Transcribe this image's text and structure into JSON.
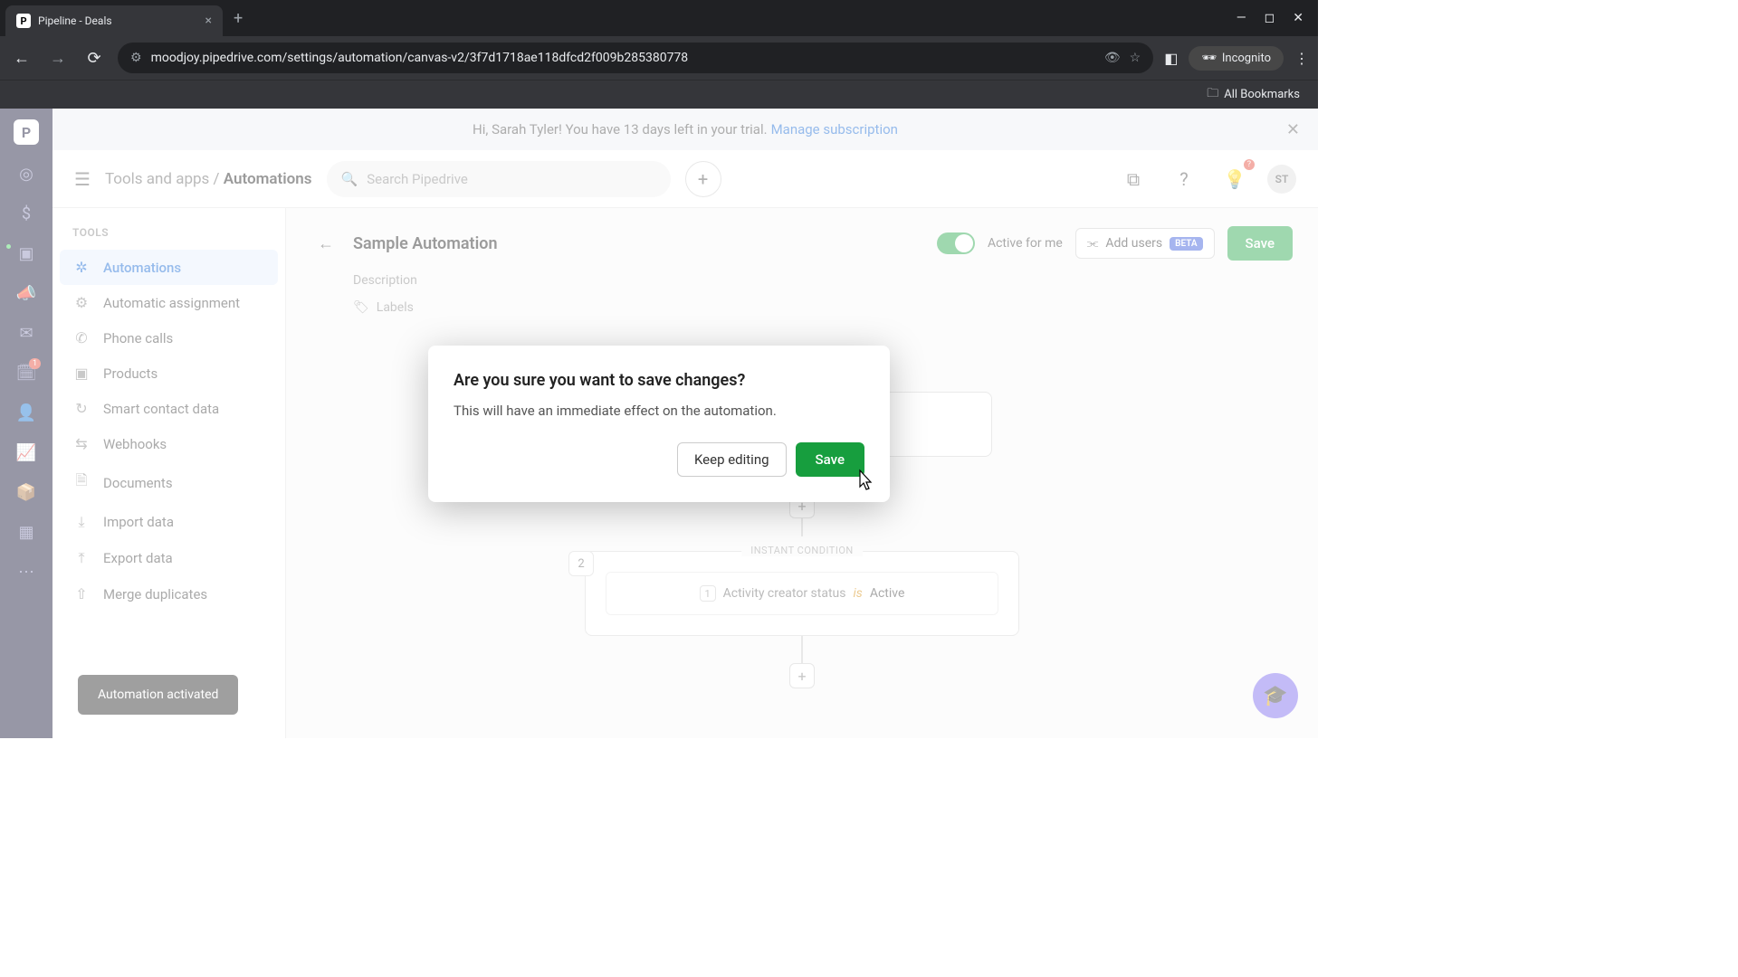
{
  "browser": {
    "tab_title": "Pipeline - Deals",
    "tab_favicon": "P",
    "url": "moodjoy.pipedrive.com/settings/automation/canvas-v2/3f7d1718ae118dfcd2f009b285380778",
    "incognito": "Incognito",
    "bookmarks_label": "All Bookmarks"
  },
  "banner": {
    "text": "Hi, Sarah Tyler! You have 13 days left in your trial.",
    "link": "Manage subscription"
  },
  "header": {
    "breadcrumb_parent": "Tools and apps",
    "breadcrumb_current": "Automations",
    "search_placeholder": "Search Pipedrive",
    "gift_badge": "?",
    "avatar": "ST"
  },
  "sidebar": {
    "heading": "TOOLS",
    "items": [
      {
        "icon": "✲",
        "label": "Automations"
      },
      {
        "icon": "⚙",
        "label": "Automatic assignment"
      },
      {
        "icon": "✆",
        "label": "Phone calls"
      },
      {
        "icon": "▣",
        "label": "Products"
      },
      {
        "icon": "↻",
        "label": "Smart contact data"
      },
      {
        "icon": "⇆",
        "label": "Webhooks"
      },
      {
        "icon": "🗎",
        "label": "Documents"
      },
      {
        "icon": "⤓",
        "label": "Import data"
      },
      {
        "icon": "⤒",
        "label": "Export data"
      },
      {
        "icon": "⇧",
        "label": "Merge duplicates"
      }
    ]
  },
  "panel": {
    "title": "Sample Automation",
    "description_placeholder": "Description",
    "labels_placeholder": "Labels",
    "active_label": "Active for me",
    "add_users": "Add users",
    "beta": "BETA",
    "save": "Save"
  },
  "canvas": {
    "step2_num": "2",
    "condition_label": "INSTANT CONDITION",
    "cond_badge": "1",
    "cond_field": "Activity creator status",
    "cond_op": "is",
    "cond_val": "Active"
  },
  "modal": {
    "title": "Are you sure you want to save changes?",
    "body": "This will have an immediate effect on the automation.",
    "keep_editing": "Keep editing",
    "save": "Save"
  },
  "toast": {
    "text": "Automation activated"
  },
  "rail_badge": "1"
}
